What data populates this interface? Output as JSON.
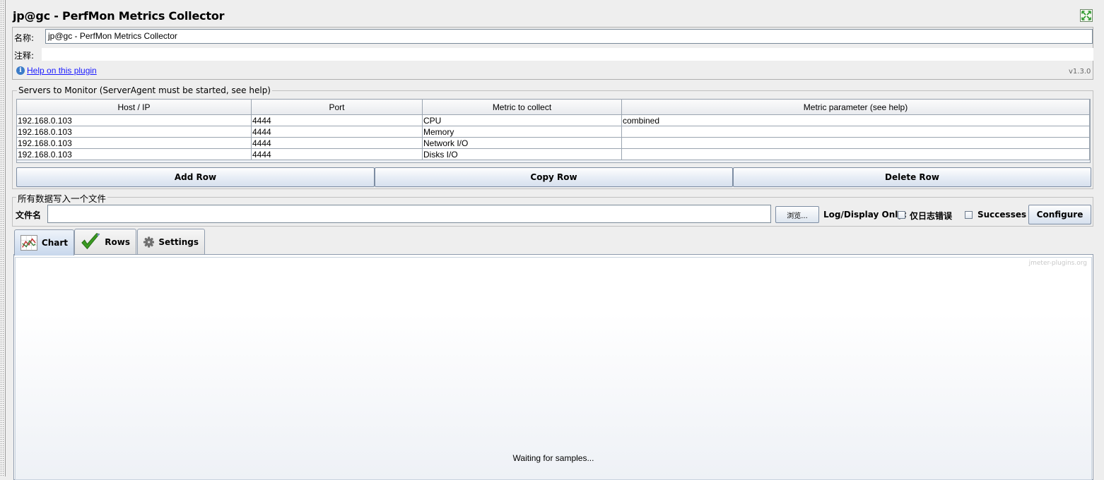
{
  "title": "jp@gc - PerfMon Metrics Collector",
  "name_label": "名称:",
  "name_value": "jp@gc - PerfMon Metrics Collector",
  "comment_label": "注释:",
  "comment_value": "",
  "help_link": "Help on this plugin",
  "version": "v1.3.0",
  "servers": {
    "legend": "Servers to Monitor (ServerAgent must be started, see help)",
    "columns": [
      "Host / IP",
      "Port",
      "Metric to collect",
      "Metric parameter (see help)"
    ],
    "rows": [
      [
        "192.168.0.103",
        "4444",
        "CPU",
        "combined"
      ],
      [
        "192.168.0.103",
        "4444",
        "Memory",
        ""
      ],
      [
        "192.168.0.103",
        "4444",
        "Network I/O",
        ""
      ],
      [
        "192.168.0.103",
        "4444",
        "Disks I/O",
        ""
      ]
    ],
    "add_row": "Add Row",
    "copy_row": "Copy Row",
    "delete_row": "Delete Row"
  },
  "file": {
    "legend": "所有数据写入一个文件",
    "filename_label": "文件名",
    "filename_value": "",
    "browse": "浏览...",
    "log_display_only": "Log/Display Only:",
    "errors_label": "仅日志错误",
    "errors_checked": false,
    "successes_label": "Successes",
    "successes_checked": false,
    "configure": "Configure"
  },
  "tabs": [
    {
      "label": "Chart",
      "icon": "chart-icon",
      "active": true
    },
    {
      "label": "Rows",
      "icon": "checkmark-icon",
      "active": false
    },
    {
      "label": "Settings",
      "icon": "gear-icon",
      "active": false
    }
  ],
  "chart": {
    "watermark": "jmeter-plugins.org",
    "waiting": "Waiting for samples..."
  },
  "colors": {
    "link": "#1a1aff",
    "active_tab": "#c7d7ec",
    "check_green": "#3a9a22"
  }
}
